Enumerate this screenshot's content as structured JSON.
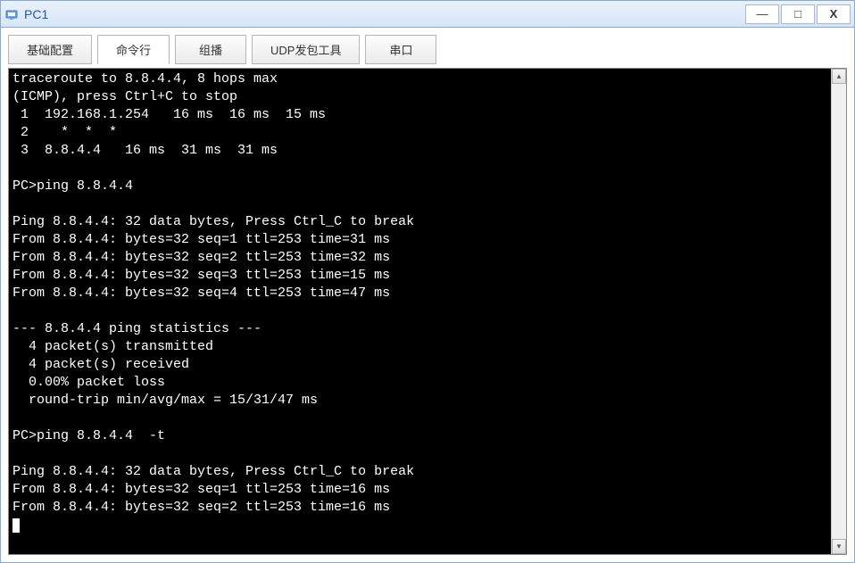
{
  "window": {
    "title": "PC1"
  },
  "tabs": {
    "basic_config": "基础配置",
    "command_line": "命令行",
    "multicast": "组播",
    "udp_tool": "UDP发包工具",
    "serial": "串口"
  },
  "terminal": {
    "lines": [
      "traceroute to 8.8.4.4, 8 hops max",
      "(ICMP), press Ctrl+C to stop",
      " 1  192.168.1.254   16 ms  16 ms  15 ms",
      " 2    *  *  *",
      " 3  8.8.4.4   16 ms  31 ms  31 ms",
      "",
      "PC>ping 8.8.4.4",
      "",
      "Ping 8.8.4.4: 32 data bytes, Press Ctrl_C to break",
      "From 8.8.4.4: bytes=32 seq=1 ttl=253 time=31 ms",
      "From 8.8.4.4: bytes=32 seq=2 ttl=253 time=32 ms",
      "From 8.8.4.4: bytes=32 seq=3 ttl=253 time=15 ms",
      "From 8.8.4.4: bytes=32 seq=4 ttl=253 time=47 ms",
      "",
      "--- 8.8.4.4 ping statistics ---",
      "  4 packet(s) transmitted",
      "  4 packet(s) received",
      "  0.00% packet loss",
      "  round-trip min/avg/max = 15/31/47 ms",
      "",
      "PC>ping 8.8.4.4  -t",
      "",
      "Ping 8.8.4.4: 32 data bytes, Press Ctrl_C to break",
      "From 8.8.4.4: bytes=32 seq=1 ttl=253 time=16 ms",
      "From 8.8.4.4: bytes=32 seq=2 ttl=253 time=16 ms"
    ]
  },
  "window_controls": {
    "minimize": "—",
    "maximize": "□",
    "close": "X"
  },
  "scroll": {
    "up": "▴",
    "down": "▾"
  }
}
